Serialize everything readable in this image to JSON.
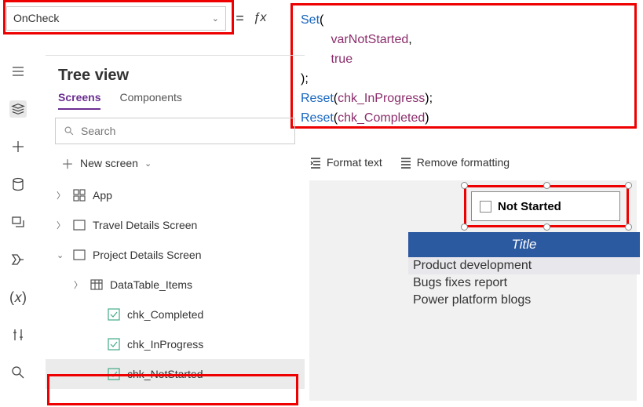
{
  "property": {
    "selected": "OnCheck"
  },
  "formula": {
    "line1_fn": "Set",
    "line1_open": "(",
    "line2_id": "varNotStarted",
    "line2_comma": ",",
    "line3_kw": "true",
    "line4": ");",
    "line5_fn": "Reset",
    "line5_open": "(",
    "line5_id": "chk_InProgress",
    "line5_close": ");",
    "line6_fn": "Reset",
    "line6_open": "(",
    "line6_id": "chk_Completed",
    "line6_close": ")"
  },
  "fmt": {
    "format": "Format text",
    "remove": "Remove formatting"
  },
  "tree": {
    "title": "Tree view",
    "tabs": {
      "screens": "Screens",
      "components": "Components"
    },
    "search_placeholder": "Search",
    "new_screen": "New screen",
    "app": "App",
    "travel": "Travel Details Screen",
    "project": "Project Details Screen",
    "datatable": "DataTable_Items",
    "chk_completed": "chk_Completed",
    "chk_inprogress": "chk_InProgress",
    "chk_notstarted": "chk_NotStarted"
  },
  "canvas": {
    "checkbox_label": "Not Started",
    "table_header": "Title",
    "rows": [
      "Product development",
      "Bugs fixes report",
      "Power platform blogs"
    ]
  }
}
